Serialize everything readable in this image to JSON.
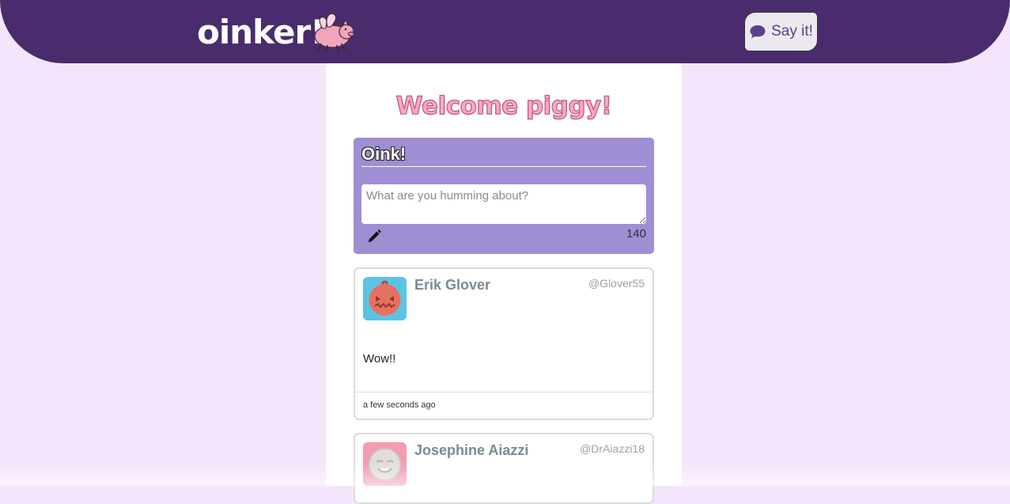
{
  "header": {
    "logo_text": "oinker!",
    "logo_icon": "flying-pig",
    "say_button_label": "Say it!",
    "say_button_icon": "comment-icon"
  },
  "main": {
    "welcome": "Welcome piggy!",
    "compose": {
      "title": "Oink!",
      "placeholder": "What are you humming about?",
      "counter": "140",
      "icon": "pencil-icon"
    },
    "oinks": [
      {
        "name": "Erik Glover",
        "handle": "@Glover55",
        "text": "Wow!!",
        "time": "a few seconds ago",
        "avatar_color": "#5bc4e3"
      },
      {
        "name": "Josephine Aiazzi",
        "handle": "@DrAiazzi18",
        "avatar_color": "#f49bb2"
      }
    ]
  },
  "colors": {
    "page_bg": "#f3e5fb",
    "header_bg": "#4a2c6e",
    "compose_bg": "#a08ed4",
    "accent_pink": "#f7a9c1"
  }
}
